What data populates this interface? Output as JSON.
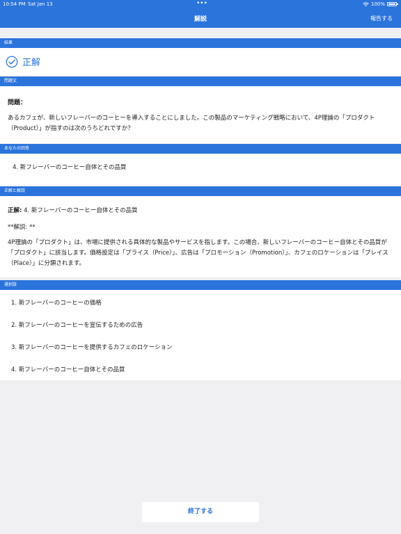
{
  "status_bar": {
    "time": "10:54 PM",
    "date": "Sat Jan 13",
    "dots": "•••",
    "battery": "100%"
  },
  "nav": {
    "title": "解説",
    "report": "報告する"
  },
  "result": {
    "header": "結果",
    "label": "正解",
    "accent_color": "#2b74dc"
  },
  "question": {
    "header": "問題文",
    "title": "問題：",
    "body": "あるカフェが、新しいフレーバーのコーヒーを導入することにしました。この製品のマーケティング戦略において、4P理論の「プロダクト（Product）」が指すのは次のうちどれですか？"
  },
  "your_answer": {
    "header": "あなたの回答",
    "text": "4. 新フレーバーのコーヒー自体とその品質"
  },
  "explanation": {
    "header": "正解と解説",
    "correct_label": "正解:",
    "correct_text": " 4. 新フレーバーのコーヒー自体とその品質",
    "mark": "**解説: **",
    "body": "4P理論の「プロダクト」は、市場に提供される具体的な製品やサービスを指します。この場合、新しいフレーバーのコーヒー自体とその品質が「プロダクト」に該当します。価格設定は「プライス（Price）」、広告は「プロモーション（Promotion）」、カフェのロケーションは「プレイス（Place）」に分類されます。"
  },
  "choices": {
    "header": "選択肢",
    "items": [
      "1.  新フレーバーのコーヒーの価格",
      "2.  新フレーバーのコーヒーを宣伝するための広告",
      "3.  新フレーバーのコーヒーを提供するカフェのロケーション",
      "4.  新フレーバーのコーヒー自体とその品質"
    ]
  },
  "footer": {
    "finish": "終了する"
  }
}
